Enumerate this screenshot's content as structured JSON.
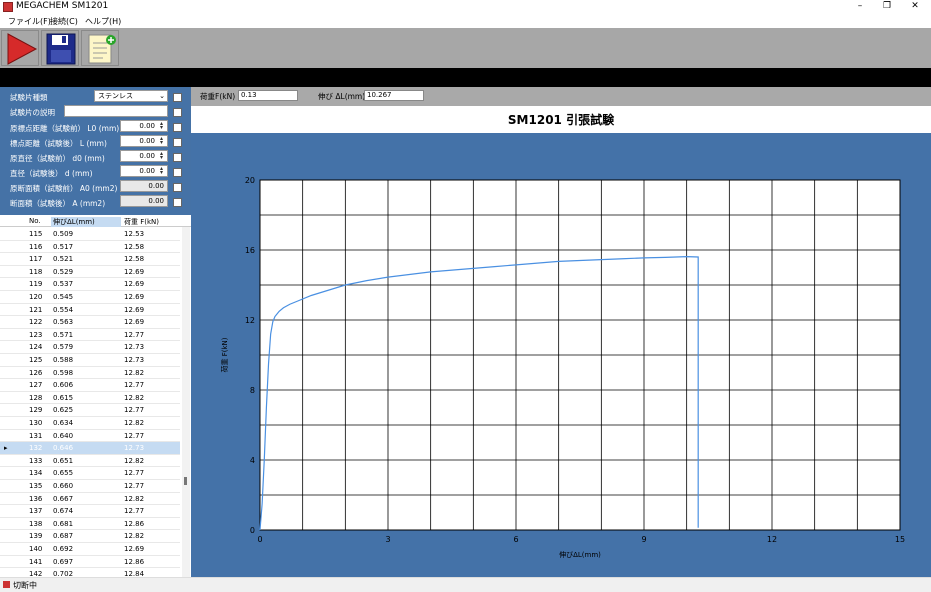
{
  "window": {
    "title": "MEGACHEM SM1201",
    "minimize": "–",
    "maximize": "❐",
    "close": "✕"
  },
  "menu": [
    "ファイル(F)",
    "接続(C)",
    "ヘルプ(H)"
  ],
  "toolbar": {
    "start_icon": "play-icon",
    "save_icon": "floppy-disk-icon",
    "new_icon": "new-document-icon"
  },
  "params": {
    "specimen_type_label": "試験片種類",
    "specimen_type_value": "ステンレス",
    "specimen_desc_label": "試験片の説明",
    "L0_label": "原標点距離（試験前） L0 (mm)",
    "L0_value": "0.00",
    "L_label": "標点距離（試験後） L (mm)",
    "L_value": "0.00",
    "d0_label": "原直径（試験前） d0 (mm)",
    "d0_value": "0.00",
    "d_label": "直径（試験後） d (mm)",
    "d_value": "0.00",
    "A0_label": "原断面積（試験前） A0 (mm2)",
    "A0_value": "0.00",
    "A_label": "断面積（試験後） A (mm2)",
    "A_value": "0.00"
  },
  "grid": {
    "headers": [
      "No.",
      "伸びΔL(mm)",
      "荷重 F(kN)"
    ],
    "selected_index": 17,
    "rows": [
      [
        "115",
        "0.509",
        "12.53"
      ],
      [
        "116",
        "0.517",
        "12.58"
      ],
      [
        "117",
        "0.521",
        "12.58"
      ],
      [
        "118",
        "0.529",
        "12.69"
      ],
      [
        "119",
        "0.537",
        "12.69"
      ],
      [
        "120",
        "0.545",
        "12.69"
      ],
      [
        "121",
        "0.554",
        "12.69"
      ],
      [
        "122",
        "0.563",
        "12.69"
      ],
      [
        "123",
        "0.571",
        "12.77"
      ],
      [
        "124",
        "0.579",
        "12.73"
      ],
      [
        "125",
        "0.588",
        "12.73"
      ],
      [
        "126",
        "0.598",
        "12.82"
      ],
      [
        "127",
        "0.606",
        "12.77"
      ],
      [
        "128",
        "0.615",
        "12.82"
      ],
      [
        "129",
        "0.625",
        "12.77"
      ],
      [
        "130",
        "0.634",
        "12.82"
      ],
      [
        "131",
        "0.640",
        "12.77"
      ],
      [
        "132",
        "0.646",
        "12.73"
      ],
      [
        "133",
        "0.651",
        "12.82"
      ],
      [
        "134",
        "0.655",
        "12.77"
      ],
      [
        "135",
        "0.660",
        "12.77"
      ],
      [
        "136",
        "0.667",
        "12.82"
      ],
      [
        "137",
        "0.674",
        "12.77"
      ],
      [
        "138",
        "0.681",
        "12.86"
      ],
      [
        "139",
        "0.687",
        "12.82"
      ],
      [
        "140",
        "0.692",
        "12.69"
      ],
      [
        "141",
        "0.697",
        "12.86"
      ],
      [
        "142",
        "0.702",
        "12.84"
      ]
    ]
  },
  "info": {
    "load_label": "荷重F(kN)",
    "load_value": "0.13",
    "elong_label": "伸び ΔL(mm)",
    "elong_value": "10.267"
  },
  "chart_data": {
    "type": "line",
    "title": "SM1201 引張試験",
    "xlabel": "伸びΔL(mm)",
    "ylabel": "荷重 F(kN)",
    "xlim": [
      0,
      15
    ],
    "ylim": [
      0,
      20
    ],
    "xticks": [
      "0",
      "3",
      "6",
      "9",
      "12",
      "15"
    ],
    "yticks": [
      "0",
      "4",
      "8",
      "12",
      "16",
      "20"
    ],
    "grid": true,
    "line_color": "#4a90e2",
    "series": [
      {
        "x": [
          0,
          0.05,
          0.1,
          0.15,
          0.2,
          0.25,
          0.3,
          0.35,
          0.45,
          0.55,
          0.7,
          0.9,
          1.2,
          1.6,
          2.0,
          2.5,
          3.0,
          3.5,
          4.0,
          4.5,
          5.0,
          5.5,
          6.0,
          6.5,
          7.0,
          7.5,
          8.0,
          8.5,
          9.0,
          9.5,
          10.0,
          10.27,
          10.27,
          10.27
        ],
        "y": [
          0,
          1.5,
          4.0,
          7.0,
          9.5,
          11.2,
          11.9,
          12.2,
          12.5,
          12.7,
          12.9,
          13.1,
          13.4,
          13.7,
          14.0,
          14.25,
          14.45,
          14.6,
          14.75,
          14.85,
          14.95,
          15.05,
          15.15,
          15.25,
          15.35,
          15.4,
          15.45,
          15.5,
          15.55,
          15.58,
          15.62,
          15.6,
          14.8,
          0.13
        ]
      }
    ]
  },
  "status": {
    "text": "切断中"
  }
}
